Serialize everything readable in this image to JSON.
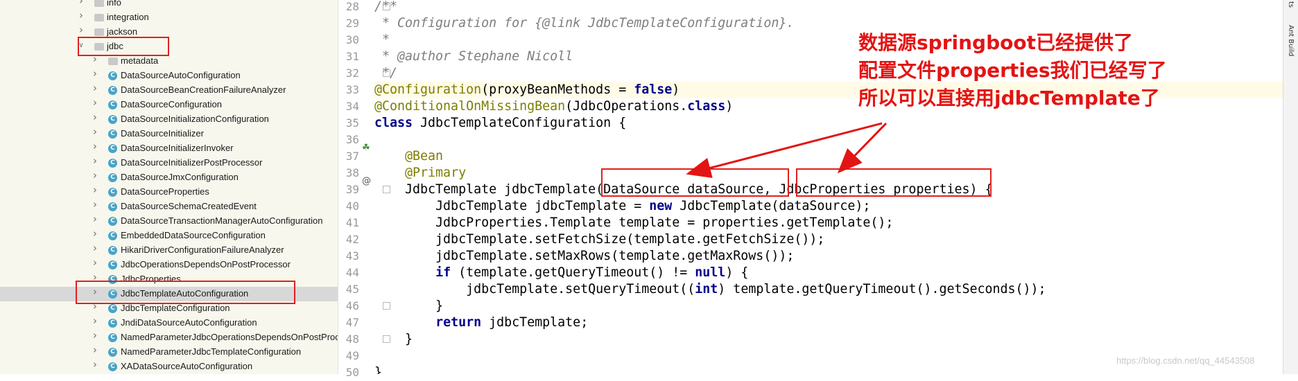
{
  "tree": {
    "items": [
      {
        "label": "info",
        "type": "package",
        "level": 1,
        "selected": false
      },
      {
        "label": "integration",
        "type": "package",
        "level": 1,
        "selected": false
      },
      {
        "label": "jackson",
        "type": "package",
        "level": 1,
        "selected": false
      },
      {
        "label": "jdbc",
        "type": "package",
        "level": 1,
        "expanded": true,
        "selected": false
      },
      {
        "label": "metadata",
        "type": "package",
        "level": 2,
        "selected": false
      },
      {
        "label": "DataSourceAutoConfiguration",
        "type": "class",
        "level": 2,
        "selected": false
      },
      {
        "label": "DataSourceBeanCreationFailureAnalyzer",
        "type": "class",
        "level": 2,
        "selected": false
      },
      {
        "label": "DataSourceConfiguration",
        "type": "class",
        "level": 2,
        "selected": false
      },
      {
        "label": "DataSourceInitializationConfiguration",
        "type": "class",
        "level": 2,
        "selected": false
      },
      {
        "label": "DataSourceInitializer",
        "type": "class",
        "level": 2,
        "selected": false
      },
      {
        "label": "DataSourceInitializerInvoker",
        "type": "class",
        "level": 2,
        "selected": false
      },
      {
        "label": "DataSourceInitializerPostProcessor",
        "type": "class",
        "level": 2,
        "selected": false
      },
      {
        "label": "DataSourceJmxConfiguration",
        "type": "class",
        "level": 2,
        "selected": false
      },
      {
        "label": "DataSourceProperties",
        "type": "class",
        "level": 2,
        "selected": false
      },
      {
        "label": "DataSourceSchemaCreatedEvent",
        "type": "class",
        "level": 2,
        "selected": false
      },
      {
        "label": "DataSourceTransactionManagerAutoConfiguration",
        "type": "class",
        "level": 2,
        "selected": false
      },
      {
        "label": "EmbeddedDataSourceConfiguration",
        "type": "class",
        "level": 2,
        "selected": false
      },
      {
        "label": "HikariDriverConfigurationFailureAnalyzer",
        "type": "class",
        "level": 2,
        "selected": false
      },
      {
        "label": "JdbcOperationsDependsOnPostProcessor",
        "type": "class",
        "level": 2,
        "selected": false
      },
      {
        "label": "JdbcProperties",
        "type": "class",
        "level": 2,
        "selected": false
      },
      {
        "label": "JdbcTemplateAutoConfiguration",
        "type": "class",
        "level": 2,
        "selected": true
      },
      {
        "label": "JdbcTemplateConfiguration",
        "type": "class",
        "level": 2,
        "selected": false
      },
      {
        "label": "JndiDataSourceAutoConfiguration",
        "type": "class",
        "level": 2,
        "selected": false
      },
      {
        "label": "NamedParameterJdbcOperationsDependsOnPostProc",
        "type": "class",
        "level": 2,
        "selected": false
      },
      {
        "label": "NamedParameterJdbcTemplateConfiguration",
        "type": "class",
        "level": 2,
        "selected": false
      },
      {
        "label": "XADataSourceAutoConfiguration",
        "type": "class",
        "level": 2,
        "selected": false
      }
    ]
  },
  "editor": {
    "lines": [
      {
        "n": "28",
        "code": "/**"
      },
      {
        "n": "29",
        "code": " * Configuration for {@link JdbcTemplateConfiguration}."
      },
      {
        "n": "30",
        "code": " *"
      },
      {
        "n": "31",
        "code": " * @author Stephane Nicoll"
      },
      {
        "n": "32",
        "code": " */"
      },
      {
        "n": "33",
        "code": "@Configuration(proxyBeanMethods = false)"
      },
      {
        "n": "34",
        "code": "@ConditionalOnMissingBean(JdbcOperations.class)"
      },
      {
        "n": "35",
        "code": "class JdbcTemplateConfiguration {"
      },
      {
        "n": "36",
        "code": ""
      },
      {
        "n": "37",
        "code": "    @Bean"
      },
      {
        "n": "38",
        "code": "    @Primary"
      },
      {
        "n": "39",
        "code": "    JdbcTemplate jdbcTemplate(DataSource dataSource, JdbcProperties properties) {"
      },
      {
        "n": "40",
        "code": "        JdbcTemplate jdbcTemplate = new JdbcTemplate(dataSource);"
      },
      {
        "n": "41",
        "code": "        JdbcProperties.Template template = properties.getTemplate();"
      },
      {
        "n": "42",
        "code": "        jdbcTemplate.setFetchSize(template.getFetchSize());"
      },
      {
        "n": "43",
        "code": "        jdbcTemplate.setMaxRows(template.getMaxRows());"
      },
      {
        "n": "44",
        "code": "        if (template.getQueryTimeout() != null) {"
      },
      {
        "n": "45",
        "code": "            jdbcTemplate.setQueryTimeout((int) template.getQueryTimeout().getSeconds());"
      },
      {
        "n": "46",
        "code": "        }"
      },
      {
        "n": "47",
        "code": "        return jdbcTemplate;"
      },
      {
        "n": "48",
        "code": "    }"
      },
      {
        "n": "49",
        "code": ""
      },
      {
        "n": "50",
        "code": "}"
      }
    ]
  },
  "annotation": {
    "lines": [
      "数据源springboot已经提供了",
      "配置文件properties我们已经写了",
      "所以可以直接用jdbcTemplate了"
    ],
    "color": "#e31414"
  },
  "side_tabs": {
    "top": "ts",
    "ant": "Ant Build"
  },
  "watermark": "https://blog.csdn.net/qq_44543508"
}
